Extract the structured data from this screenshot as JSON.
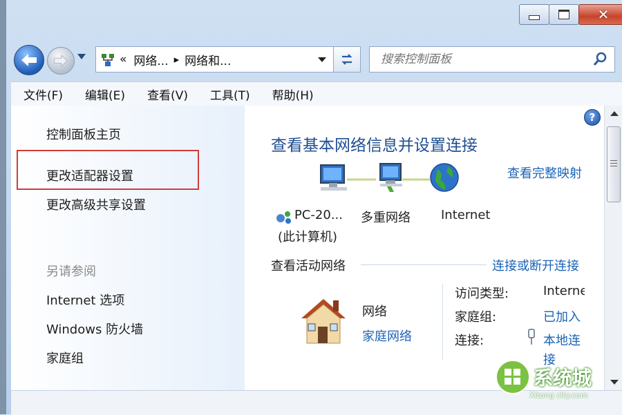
{
  "nav": {
    "address": {
      "chevron": "«",
      "crumb1": "网络...",
      "separator": "▸",
      "crumb2": "网络和..."
    },
    "search_placeholder": "搜索控制面板"
  },
  "menu": [
    "文件(F)",
    "编辑(E)",
    "查看(V)",
    "工具(T)",
    "帮助(H)"
  ],
  "sidebar": {
    "home": "控制面板主页",
    "adapter_settings": "更改适配器设置",
    "advanced_sharing": "更改高级共享设置",
    "see_also": "另请参阅",
    "internet_options": "Internet 选项",
    "firewall": "Windows 防火墙",
    "homegroup": "家庭组"
  },
  "main": {
    "title": "查看基本网络信息并设置连接",
    "view_full_map": "查看完整映射",
    "map": {
      "computer_label": "PC-20...",
      "computer_sub": "(此计算机)",
      "network_label": "多重网络",
      "internet_label": "Internet"
    },
    "active_networks_title": "查看活动网络",
    "connect_disconnect": "连接或断开连接",
    "network": {
      "name": "网络",
      "type": "家庭网络"
    },
    "details": {
      "access_type_key": "访问类型:",
      "access_type_val": "Interne",
      "homegroup_key": "家庭组:",
      "homegroup_val": "已加入",
      "connection_key": "连接:",
      "connection_val_line1": "本地连",
      "connection_val_line2": "接"
    }
  },
  "watermark": {
    "brand": "系统城",
    "url": "Xitong city.com"
  },
  "colors": {
    "link": "#1b63b6",
    "title": "#1f4e91",
    "highlight": "#d23a3a"
  }
}
